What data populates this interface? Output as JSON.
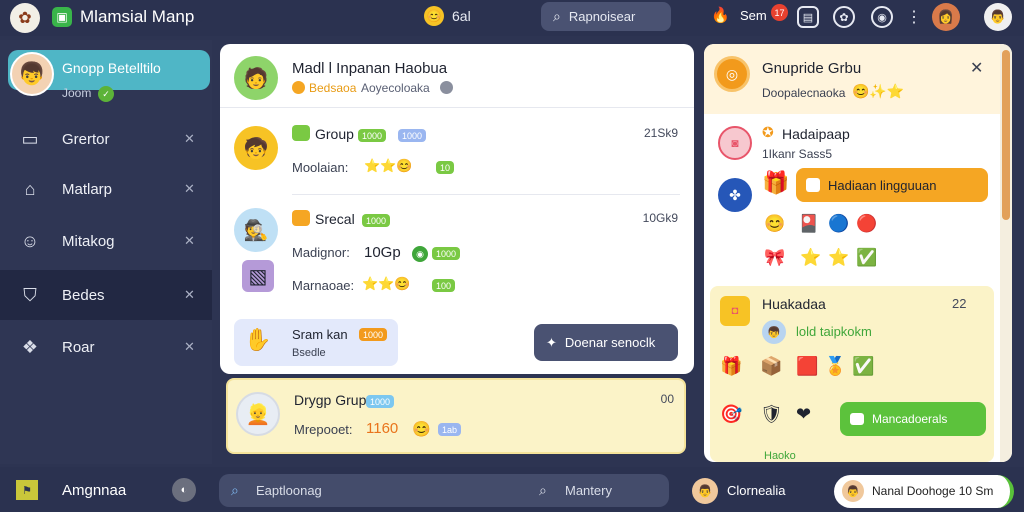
{
  "topbar": {
    "title": "Mlamsial Manp",
    "subtitle": "6al",
    "search_placeholder": "Rapnoisear",
    "username": "Sem",
    "notif_count": "17"
  },
  "sidebar": {
    "profile_name": "Gnopp Betelltilo",
    "profile_status": "Joom",
    "items": [
      {
        "label": "Grertor",
        "icon": "briefcase-icon"
      },
      {
        "label": "Matlarp",
        "icon": "home-icon"
      },
      {
        "label": "Mitakog",
        "icon": "people-icon"
      },
      {
        "label": "Bedes",
        "icon": "shield-icon"
      },
      {
        "label": "Roar",
        "icon": "chat-icon"
      }
    ]
  },
  "center": {
    "header": {
      "title": "Madl l Inpanan Haobua",
      "sub1": "Bedsaoa",
      "sub2": "Aoyecoloaka"
    },
    "rows": [
      {
        "name": "Group",
        "time": "21Sk9",
        "tag1": "1000",
        "tag2": "1000",
        "label": "Moolaian:",
        "emoji": "⭐⭐😊"
      },
      {
        "name": "Srecal",
        "time": "10Gk9",
        "tag1": "1000",
        "label": "Madignor:",
        "value": "10Gp",
        "label2": "Marnaoae:",
        "emoji2": "⭐⭐😊"
      }
    ],
    "footer": {
      "left_title": "Sram kan",
      "left_badge": "1000",
      "left_sub": "Bsedle",
      "button": "Doenar senoclk"
    },
    "yellow_card": {
      "name": "Drygp Grup",
      "tag": "1000",
      "time": "00",
      "label": "Mrepooet:",
      "value": "1160",
      "tag2": "1ab"
    }
  },
  "right": {
    "header": {
      "title": "Gnupride Grbu",
      "sub": "Doopalecnaoka"
    },
    "section1": {
      "title": "Hadaipaap",
      "sub": "1Ikanr Sass5",
      "button": "Hadiaan lingguuan"
    },
    "yellow": {
      "title": "Huakadaa",
      "time": "22",
      "link": "lold taipkokm",
      "button": "Mancadoerals",
      "cut_text": "Haoko"
    }
  },
  "bottombar": {
    "label": "Amgnnaa",
    "search1": "Eaptloonag",
    "search2": "Mantery",
    "user": "Clornealia",
    "pill": "Nanal Doohoge 10 Sm"
  }
}
